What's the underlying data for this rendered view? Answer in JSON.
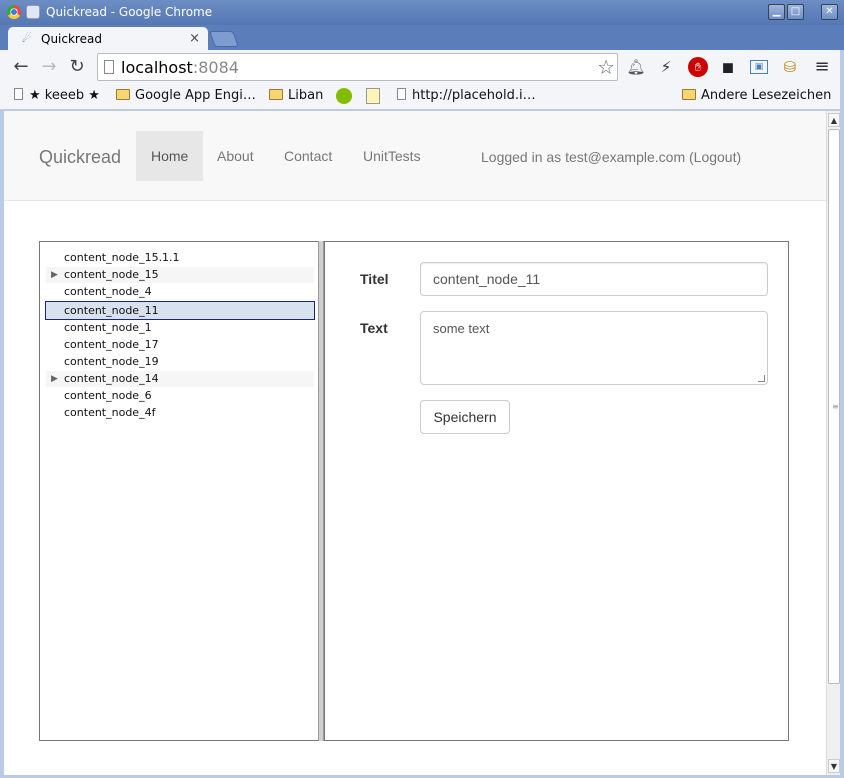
{
  "window": {
    "title": "Quickread - Google Chrome"
  },
  "tab": {
    "label": "Quickread",
    "close": "×"
  },
  "toolbar": {
    "url_host": "localhost",
    "url_port": ":8084"
  },
  "bookmarks": {
    "items": [
      {
        "label": "★ keeeb ★",
        "icon": "page-icon"
      },
      {
        "label": "Google App Engi…",
        "icon": "folder-icon"
      },
      {
        "label": "Liban",
        "icon": "folder-icon"
      },
      {
        "label": "http://placehold.i…",
        "icon": "page-icon"
      }
    ],
    "other": "Andere Lesezeichen"
  },
  "navbar": {
    "brand": "Quickread",
    "links": [
      "Home",
      "About",
      "Contact",
      "UnitTests"
    ],
    "active": "Home",
    "logged_in": "Logged in as test@example.com (Logout)"
  },
  "tree": {
    "nodes": [
      {
        "label": "content_node_15.1.1",
        "expandable": false,
        "selected": false
      },
      {
        "label": "content_node_15",
        "expandable": true,
        "selected": false
      },
      {
        "label": "content_node_4",
        "expandable": false,
        "selected": false
      },
      {
        "label": "content_node_11",
        "expandable": false,
        "selected": true
      },
      {
        "label": "content_node_1",
        "expandable": false,
        "selected": false
      },
      {
        "label": "content_node_17",
        "expandable": false,
        "selected": false
      },
      {
        "label": "content_node_19",
        "expandable": false,
        "selected": false
      },
      {
        "label": "content_node_14",
        "expandable": true,
        "selected": false
      },
      {
        "label": "content_node_6",
        "expandable": false,
        "selected": false
      },
      {
        "label": "content_node_4f",
        "expandable": false,
        "selected": false
      }
    ]
  },
  "editor": {
    "title_label": "Titel",
    "title_value": "content_node_11",
    "text_label": "Text",
    "text_value": "some text",
    "save_label": "Speichern"
  }
}
